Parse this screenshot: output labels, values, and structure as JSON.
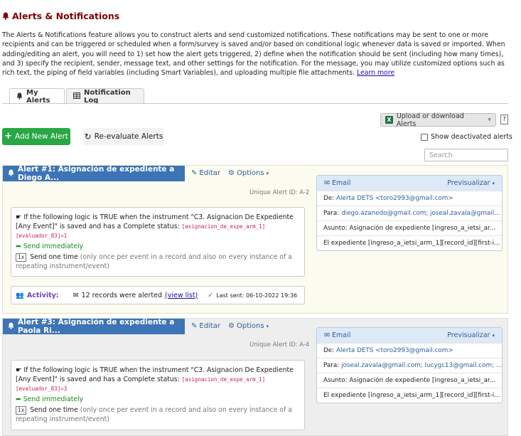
{
  "page": {
    "title": "Alerts & Notifications",
    "intro": "The Alerts & Notifications feature allows you to construct alerts and send customized notifications. These notifications may be sent to one or more recipients and can be triggered or scheduled when a form/survey is saved and/or based on conditional logic whenever data is saved or imported. When adding/editing an alert, you will need to 1) set how the alert gets triggered, 2) define when the notification should be sent (including how many times), and 3) specify the recipient, sender, message text, and other settings for the notification. For the message, you may utilize customized options such as rich text, the piping of field variables (including Smart Variables), and uploading multiple file attachments.",
    "learn_more": "Learn more"
  },
  "tabs": [
    {
      "label": "My Alerts",
      "icon": "bell-icon",
      "active": true
    },
    {
      "label": "Notification Log",
      "icon": "table-icon",
      "active": false
    }
  ],
  "toolbar": {
    "upload_label": "Upload or download Alerts",
    "help_label": "?",
    "add_label": "Add New Alert",
    "reevaluate_label": "Re-evaluate Alerts",
    "show_deactivated_label": "Show deactivated alerts",
    "search_placeholder": "Search"
  },
  "alerts": [
    {
      "header": "Alert #1: Asignación de expediente a Diego A...",
      "edit_label": "Editar",
      "options_label": "Options",
      "unique_id": "Unique Alert ID: A-2",
      "logic_text": "If the following logic is TRUE when the instrument \"C3. Asignacion De Expediente [Any Event]\" is saved and has a Complete status:",
      "logic_code1": "[asignacion_de_expe_arm_1]",
      "logic_code2": "[evaluador_83]=1",
      "send_timing": "Send immediately",
      "once_badge": "1x",
      "send_times": "Send one time",
      "send_times_note": "(only once per event in a record and also on every instance of a repeating instrument/event)",
      "activity_label": "Activity:",
      "activity_text": "12 records were alerted",
      "view_list": "(view list)",
      "last_sent": "Last sent: 06-10-2022 19:36",
      "email": {
        "label": "Email",
        "preview": "Previsualizar",
        "from_label": "De:",
        "from_value": "Alerta DETS <toro2993@gmail.com>",
        "to_label": "Para:",
        "to_value": "diego.azanedo@gmail.com; joseal.zavala@gmail...",
        "subject_label": "Asunto:",
        "subject_value": "Asignación de expediente [ingreso_a_ietsi_ar...",
        "body": "El expediente [ingreso_a_ietsi_arm_1][record_id][first-i..."
      }
    },
    {
      "header": "Alert #3: Asignación de expediente a Paola Ri...",
      "edit_label": "Editar",
      "options_label": "Options",
      "unique_id": "Unique Alert ID: A-4",
      "logic_text": "If the following logic is TRUE when the instrument \"C3. Asignacion De Expediente [Any Event]\" is saved and has a Complete status:",
      "logic_code1": "[asignacion_de_expe_arm_1]",
      "logic_code2": "[evaluador_83]=3",
      "send_timing": "Send immediately",
      "once_badge": "1x",
      "send_times": "Send one time",
      "send_times_note": "(only once per event in a record and also on every instance of a repeating instrument/event)",
      "email": {
        "label": "Email",
        "preview": "Previsualizar",
        "from_label": "De:",
        "from_value": "Alerta DETS <toro2993@gmail.com>",
        "to_label": "Para:",
        "to_value": "joseal.zavala@gmail.com; lucygc13@gmail.com; ...",
        "subject_label": "Asunto:",
        "subject_value": "Asignación de expediente [ingreso_a_ietsi_ar...",
        "body": "El expediente [ingreso_a_ietsi_arm_1][record_id][first-i..."
      }
    }
  ],
  "colors": {
    "title": "#800000",
    "alert_header": "#3c74b5",
    "add_button": "#28a745",
    "panel1_bg": "#fbfbef",
    "panel2_bg": "#eeeeee"
  }
}
